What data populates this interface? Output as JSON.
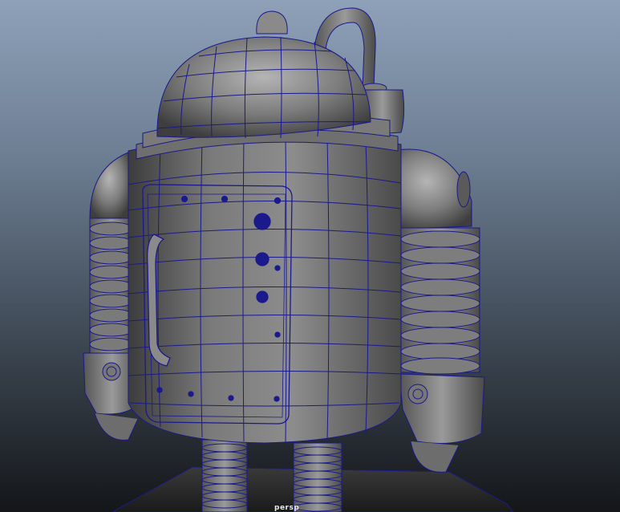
{
  "viewport": {
    "background_top": "#8ea1b8",
    "background_bottom": "#141619",
    "wireframe_color": "#1a1a8c",
    "shading_color": "#8a8a8a",
    "status_label": "persp"
  }
}
